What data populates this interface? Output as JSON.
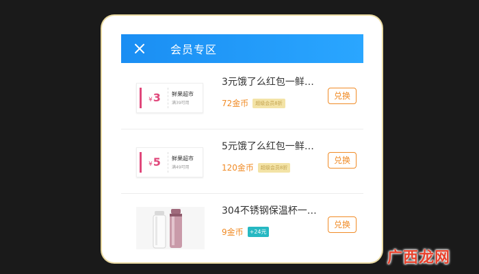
{
  "header": {
    "title": "会员专区",
    "close_icon": "close-icon"
  },
  "items": [
    {
      "name": "3元饿了么红包一鲜…",
      "price": "72金币",
      "tag": "超级会员8折",
      "button": "兑换",
      "coupon": {
        "currency": "¥",
        "amount": "3",
        "title": "鲜果超市",
        "condition": "满39可用"
      }
    },
    {
      "name": "5元饿了么红包一鲜…",
      "price": "120金币",
      "tag": "超级会员8折",
      "button": "兑换",
      "coupon": {
        "currency": "¥",
        "amount": "5",
        "title": "鲜果超市",
        "condition": "满49可用"
      }
    },
    {
      "name": "304不锈钢保温杯一…",
      "price": "9金币",
      "tag": "+24元",
      "button": "兑换",
      "image": "thermos-bottles"
    }
  ],
  "watermark": "广西龙网",
  "colors": {
    "header": "#1a8ef3",
    "accent": "#f08a24",
    "coupon": "#e0467a"
  }
}
